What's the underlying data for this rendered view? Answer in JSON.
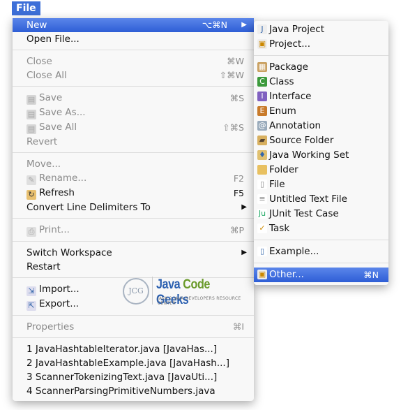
{
  "menubar": {
    "title": "File"
  },
  "colors": {
    "highlight": "#3d6fd8",
    "disabled": "#8a8a8a"
  },
  "main_menu": [
    {
      "label": "New",
      "shortcut": "⌥⌘N",
      "submenu": true,
      "highlighted": true
    },
    {
      "label": "Open File..."
    },
    {
      "sep": true
    },
    {
      "label": "Close",
      "shortcut": "⌘W",
      "disabled": true
    },
    {
      "label": "Close All",
      "shortcut": "⇧⌘W",
      "disabled": true
    },
    {
      "sep": true
    },
    {
      "label": "Save",
      "shortcut": "⌘S",
      "disabled": true,
      "icon": "save-icon"
    },
    {
      "label": "Save As...",
      "disabled": true,
      "icon": "save-as-icon"
    },
    {
      "label": "Save All",
      "shortcut": "⇧⌘S",
      "disabled": true,
      "icon": "save-all-icon"
    },
    {
      "label": "Revert",
      "disabled": true
    },
    {
      "sep": true
    },
    {
      "label": "Move...",
      "disabled": true
    },
    {
      "label": "Rename...",
      "shortcut": "F2",
      "disabled": true,
      "icon": "rename-icon"
    },
    {
      "label": "Refresh",
      "shortcut": "F5",
      "icon": "refresh-icon"
    },
    {
      "label": "Convert Line Delimiters To",
      "submenu": true
    },
    {
      "sep": true
    },
    {
      "label": "Print...",
      "shortcut": "⌘P",
      "disabled": true,
      "icon": "print-icon"
    },
    {
      "sep": true
    },
    {
      "label": "Switch Workspace",
      "submenu": true
    },
    {
      "label": "Restart"
    },
    {
      "sep": true
    },
    {
      "label": "Import...",
      "icon": "import-icon"
    },
    {
      "label": "Export...",
      "icon": "export-icon"
    },
    {
      "sep": true
    },
    {
      "label": "Properties",
      "shortcut": "⌘I",
      "disabled": true
    },
    {
      "sep": true
    },
    {
      "label": "1 JavaHashtableIterator.java  [JavaHas...]"
    },
    {
      "label": "2 JavaHashtableExample.java  [JavaHash...]"
    },
    {
      "label": "3 ScannerTokenizingText.java  [JavaUti...]"
    },
    {
      "label": "4 ScannerParsingPrimitiveNumbers.java"
    }
  ],
  "sub_menu": [
    {
      "label": "Java Project",
      "icon": "java-project-icon"
    },
    {
      "label": "Project...",
      "icon": "project-icon"
    },
    {
      "sep": true
    },
    {
      "label": "Package",
      "icon": "package-icon"
    },
    {
      "label": "Class",
      "icon": "class-icon"
    },
    {
      "label": "Interface",
      "icon": "interface-icon"
    },
    {
      "label": "Enum",
      "icon": "enum-icon"
    },
    {
      "label": "Annotation",
      "icon": "annotation-icon"
    },
    {
      "label": "Source Folder",
      "icon": "source-folder-icon"
    },
    {
      "label": "Java Working Set",
      "icon": "working-set-icon"
    },
    {
      "label": "Folder",
      "icon": "folder-icon"
    },
    {
      "label": "File",
      "icon": "file-icon"
    },
    {
      "label": "Untitled Text File",
      "icon": "text-file-icon"
    },
    {
      "label": "JUnit Test Case",
      "icon": "junit-icon"
    },
    {
      "label": "Task",
      "icon": "task-icon"
    },
    {
      "sep": true
    },
    {
      "label": "Example...",
      "icon": "example-icon"
    },
    {
      "sep": true
    },
    {
      "label": "Other...",
      "shortcut": "⌘N",
      "icon": "other-icon",
      "highlighted": true
    }
  ],
  "watermark": {
    "initials": "JCG",
    "name_part1": "Java ",
    "name_part2": "Code ",
    "name_part3": "Geeks",
    "tagline": "JAVA 2 JAVA DEVELOPERS RESOURCE CENTER"
  }
}
